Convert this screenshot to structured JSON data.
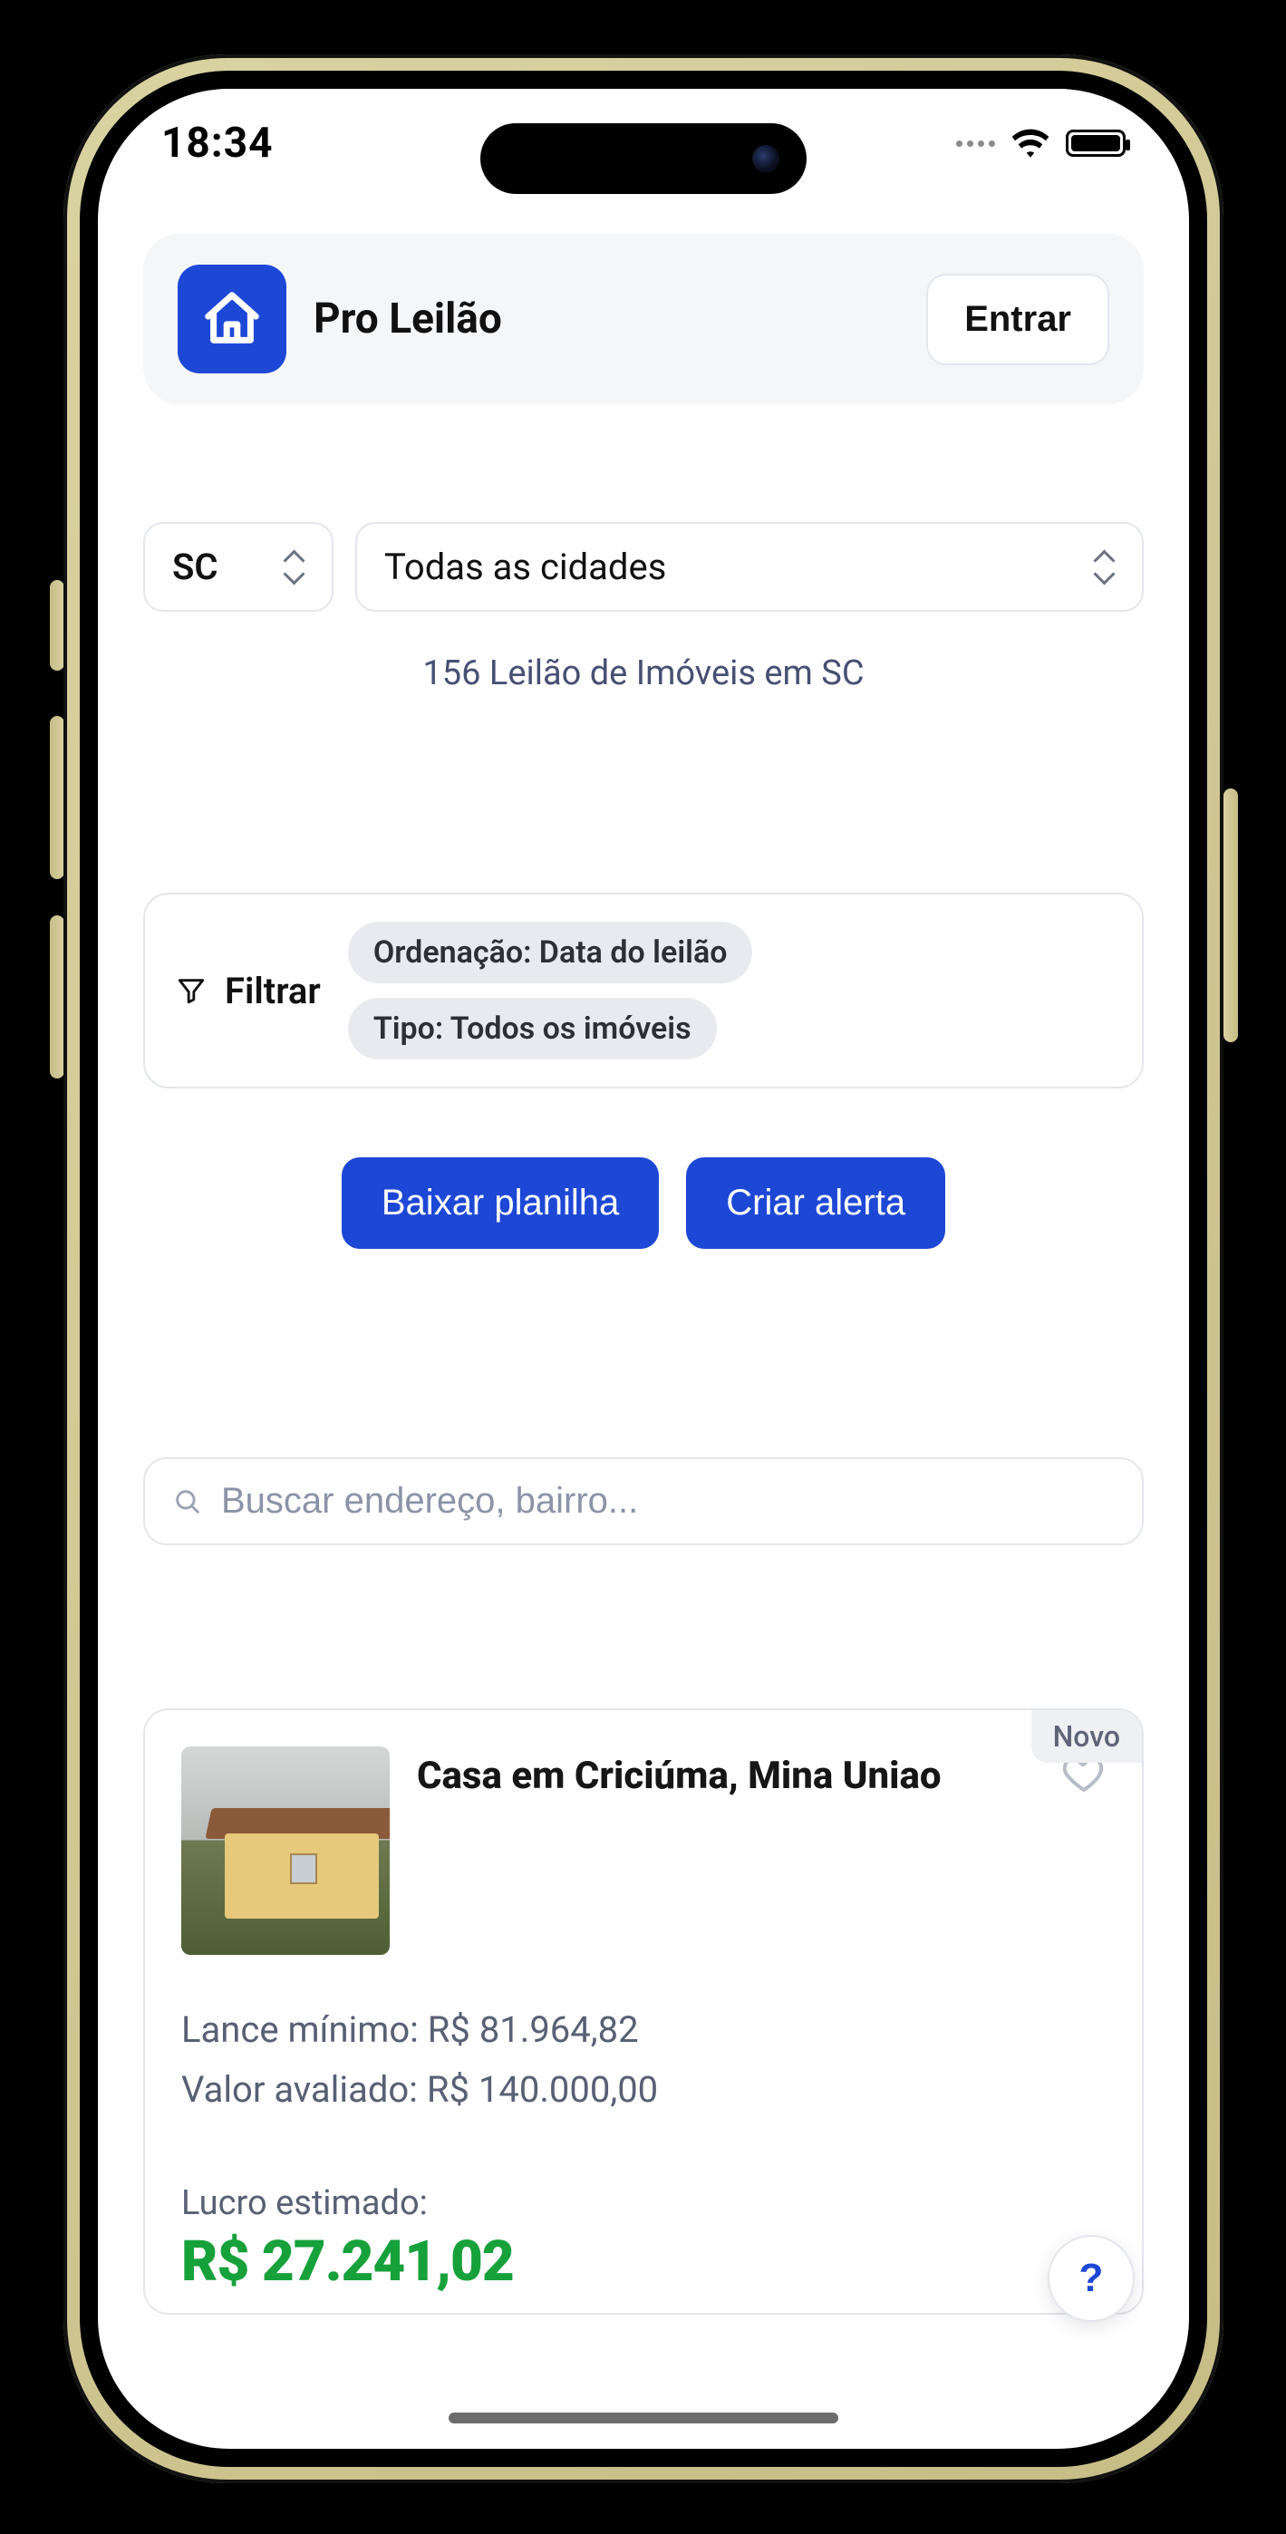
{
  "status": {
    "time": "18:34"
  },
  "header": {
    "app_name": "Pro Leilão",
    "login_label": "Entrar"
  },
  "filters": {
    "state": "SC",
    "city": "Todas as cidades",
    "count_text": "156 Leilão de Imóveis em SC",
    "filter_label": "Filtrar",
    "sort_chip": "Ordenação: Data do leilão",
    "type_chip": "Tipo: Todos os imóveis"
  },
  "actions": {
    "download_label": "Baixar planilha",
    "alert_label": "Criar alerta"
  },
  "search": {
    "placeholder": "Buscar endereço, bairro..."
  },
  "listing": {
    "badge": "Novo",
    "title": "Casa em Criciúma, Mina Uniao",
    "min_bid_label": "Lance mínimo:",
    "min_bid_value": "R$ 81.964,82",
    "appraised_label": "Valor avaliado:",
    "appraised_value": "R$ 140.000,00",
    "profit_label": "Lucro estimado:",
    "profit_value": "R$ 27.241,02"
  },
  "fab": {
    "label": "?"
  }
}
